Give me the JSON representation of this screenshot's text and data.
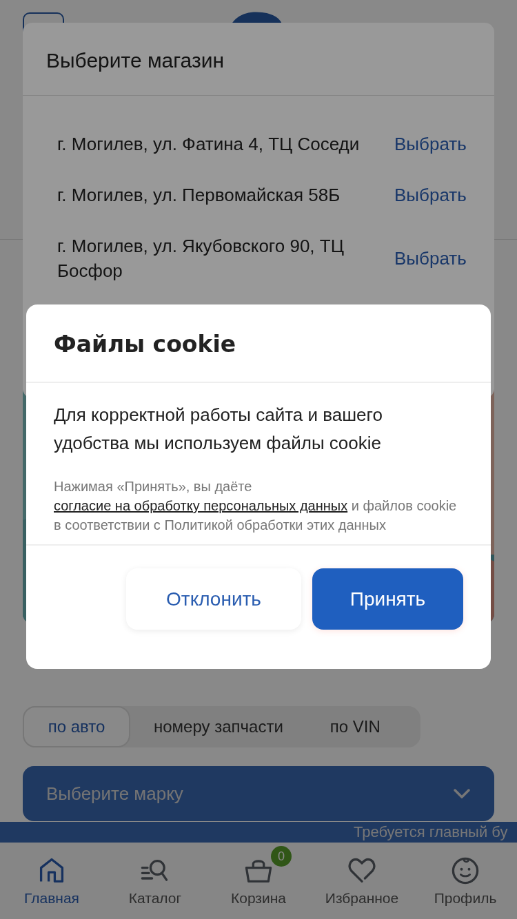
{
  "store_picker": {
    "title": "Выберите магазин",
    "stores": [
      {
        "address": "г. Могилев, ул. Фатина 4, ТЦ Соседи",
        "action": "Выбрать"
      },
      {
        "address": "г. Могилев, ул. Первомайская 58Б",
        "action": "Выбрать"
      },
      {
        "address": "г. Могилев, ул. Якубовского 90, ТЦ Босфор",
        "action": "Выбрать"
      }
    ]
  },
  "cookie_dialog": {
    "title": "Файлы cookie",
    "message": "Для корректной работы сайта и вашего удобства мы используем файлы cookie",
    "consent": {
      "before": "Нажимая «Принять», вы даёте",
      "link": "согласие на обработку персональных данных",
      "after": "и файлов cookie в соответствии с Политикой обработки этих данных"
    },
    "buttons": [
      {
        "label": "Отклонить",
        "kind": "secondary"
      },
      {
        "label": "Принять",
        "kind": "primary"
      }
    ]
  },
  "brand_search": {
    "tabs": [
      {
        "label": "по авто",
        "selected": true
      },
      {
        "label": "номеру запчасти",
        "selected": false
      },
      {
        "label": "по VIN",
        "selected": false
      }
    ],
    "select": {
      "placeholder": "Выберите марку"
    }
  },
  "ticker": {
    "text": "Требуется главный бу"
  },
  "bottom_nav": [
    {
      "label": "Главная",
      "kind": "home",
      "selected": true
    },
    {
      "label": "Каталог",
      "kind": "catalog",
      "selected": false
    },
    {
      "label": "Корзина",
      "kind": "cart",
      "selected": false,
      "badge": "0"
    },
    {
      "label": "Избранное",
      "kind": "favorites",
      "selected": false
    },
    {
      "label": "Профиль",
      "kind": "profile",
      "selected": false
    }
  ]
}
